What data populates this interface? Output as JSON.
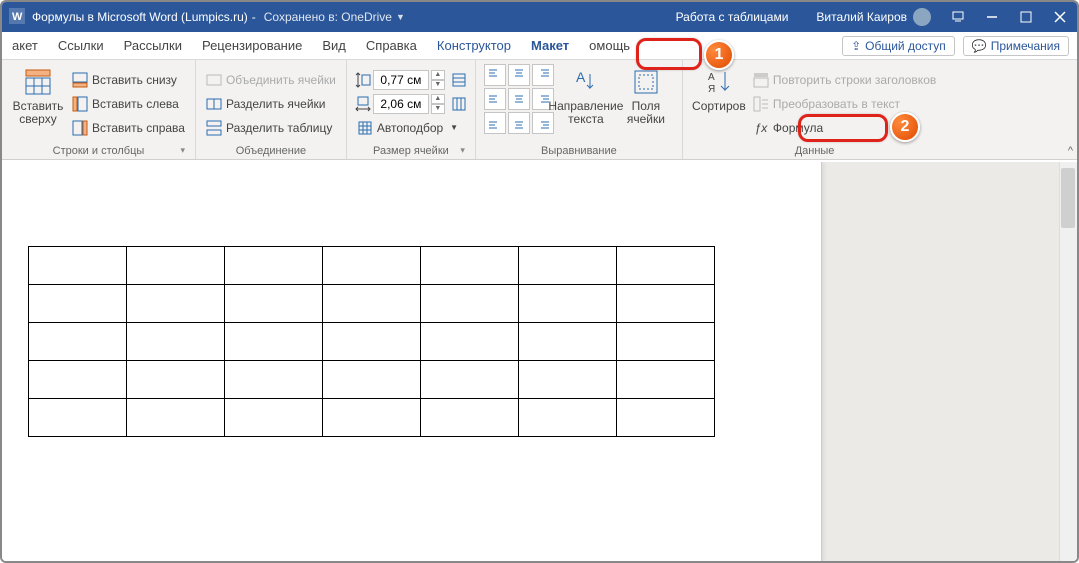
{
  "title": {
    "doc": "Формулы в Microsoft Word (Lumpics.ru)",
    "saved": "Сохранено в: OneDrive",
    "context": "Работа с таблицами",
    "user": "Виталий Каиров"
  },
  "tabs": {
    "t0": "акет",
    "links": "Ссылки",
    "mailings": "Рассылки",
    "review": "Рецензирование",
    "view": "Вид",
    "help": "Справка",
    "designer": "Конструктор",
    "layout": "Макет",
    "what": "омощь",
    "share": "Общий доступ",
    "comments": "Примечания"
  },
  "ribbon": {
    "rows_cols": {
      "insert_above": "Вставить сверху",
      "insert_below": "Вставить снизу",
      "insert_left": "Вставить слева",
      "insert_right": "Вставить справа",
      "label": "Строки и столбцы"
    },
    "merge": {
      "merge": "Объединить ячейки",
      "split_cells": "Разделить ячейки",
      "split_table": "Разделить таблицу",
      "label": "Объединение"
    },
    "size": {
      "height": "0,77 см",
      "width": "2,06 см",
      "autofit": "Автоподбор",
      "label": "Размер ячейки"
    },
    "align": {
      "direction": "Направление текста",
      "margins": "Поля ячейки",
      "label": "Выравнивание"
    },
    "data": {
      "sort": "Сортиров",
      "repeat": "Повторить строки заголовков",
      "convert": "Преобразовать в текст",
      "formula": "Формула",
      "label": "Данные"
    }
  },
  "callouts": {
    "one": "1",
    "two": "2"
  },
  "table": {
    "rows": 5,
    "cols": 7
  }
}
